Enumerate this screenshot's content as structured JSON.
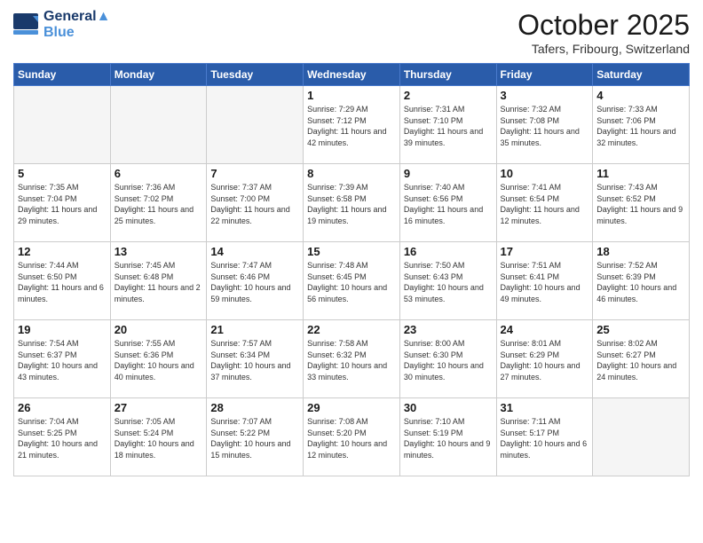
{
  "header": {
    "logo_line1": "General",
    "logo_line2": "Blue",
    "month": "October 2025",
    "location": "Tafers, Fribourg, Switzerland"
  },
  "days_of_week": [
    "Sunday",
    "Monday",
    "Tuesday",
    "Wednesday",
    "Thursday",
    "Friday",
    "Saturday"
  ],
  "weeks": [
    [
      {
        "num": "",
        "info": "",
        "empty": true
      },
      {
        "num": "",
        "info": "",
        "empty": true
      },
      {
        "num": "",
        "info": "",
        "empty": true
      },
      {
        "num": "1",
        "info": "Sunrise: 7:29 AM\nSunset: 7:12 PM\nDaylight: 11 hours\nand 42 minutes.",
        "empty": false
      },
      {
        "num": "2",
        "info": "Sunrise: 7:31 AM\nSunset: 7:10 PM\nDaylight: 11 hours\nand 39 minutes.",
        "empty": false
      },
      {
        "num": "3",
        "info": "Sunrise: 7:32 AM\nSunset: 7:08 PM\nDaylight: 11 hours\nand 35 minutes.",
        "empty": false
      },
      {
        "num": "4",
        "info": "Sunrise: 7:33 AM\nSunset: 7:06 PM\nDaylight: 11 hours\nand 32 minutes.",
        "empty": false
      }
    ],
    [
      {
        "num": "5",
        "info": "Sunrise: 7:35 AM\nSunset: 7:04 PM\nDaylight: 11 hours\nand 29 minutes.",
        "empty": false
      },
      {
        "num": "6",
        "info": "Sunrise: 7:36 AM\nSunset: 7:02 PM\nDaylight: 11 hours\nand 25 minutes.",
        "empty": false
      },
      {
        "num": "7",
        "info": "Sunrise: 7:37 AM\nSunset: 7:00 PM\nDaylight: 11 hours\nand 22 minutes.",
        "empty": false
      },
      {
        "num": "8",
        "info": "Sunrise: 7:39 AM\nSunset: 6:58 PM\nDaylight: 11 hours\nand 19 minutes.",
        "empty": false
      },
      {
        "num": "9",
        "info": "Sunrise: 7:40 AM\nSunset: 6:56 PM\nDaylight: 11 hours\nand 16 minutes.",
        "empty": false
      },
      {
        "num": "10",
        "info": "Sunrise: 7:41 AM\nSunset: 6:54 PM\nDaylight: 11 hours\nand 12 minutes.",
        "empty": false
      },
      {
        "num": "11",
        "info": "Sunrise: 7:43 AM\nSunset: 6:52 PM\nDaylight: 11 hours\nand 9 minutes.",
        "empty": false
      }
    ],
    [
      {
        "num": "12",
        "info": "Sunrise: 7:44 AM\nSunset: 6:50 PM\nDaylight: 11 hours\nand 6 minutes.",
        "empty": false
      },
      {
        "num": "13",
        "info": "Sunrise: 7:45 AM\nSunset: 6:48 PM\nDaylight: 11 hours\nand 2 minutes.",
        "empty": false
      },
      {
        "num": "14",
        "info": "Sunrise: 7:47 AM\nSunset: 6:46 PM\nDaylight: 10 hours\nand 59 minutes.",
        "empty": false
      },
      {
        "num": "15",
        "info": "Sunrise: 7:48 AM\nSunset: 6:45 PM\nDaylight: 10 hours\nand 56 minutes.",
        "empty": false
      },
      {
        "num": "16",
        "info": "Sunrise: 7:50 AM\nSunset: 6:43 PM\nDaylight: 10 hours\nand 53 minutes.",
        "empty": false
      },
      {
        "num": "17",
        "info": "Sunrise: 7:51 AM\nSunset: 6:41 PM\nDaylight: 10 hours\nand 49 minutes.",
        "empty": false
      },
      {
        "num": "18",
        "info": "Sunrise: 7:52 AM\nSunset: 6:39 PM\nDaylight: 10 hours\nand 46 minutes.",
        "empty": false
      }
    ],
    [
      {
        "num": "19",
        "info": "Sunrise: 7:54 AM\nSunset: 6:37 PM\nDaylight: 10 hours\nand 43 minutes.",
        "empty": false
      },
      {
        "num": "20",
        "info": "Sunrise: 7:55 AM\nSunset: 6:36 PM\nDaylight: 10 hours\nand 40 minutes.",
        "empty": false
      },
      {
        "num": "21",
        "info": "Sunrise: 7:57 AM\nSunset: 6:34 PM\nDaylight: 10 hours\nand 37 minutes.",
        "empty": false
      },
      {
        "num": "22",
        "info": "Sunrise: 7:58 AM\nSunset: 6:32 PM\nDaylight: 10 hours\nand 33 minutes.",
        "empty": false
      },
      {
        "num": "23",
        "info": "Sunrise: 8:00 AM\nSunset: 6:30 PM\nDaylight: 10 hours\nand 30 minutes.",
        "empty": false
      },
      {
        "num": "24",
        "info": "Sunrise: 8:01 AM\nSunset: 6:29 PM\nDaylight: 10 hours\nand 27 minutes.",
        "empty": false
      },
      {
        "num": "25",
        "info": "Sunrise: 8:02 AM\nSunset: 6:27 PM\nDaylight: 10 hours\nand 24 minutes.",
        "empty": false
      }
    ],
    [
      {
        "num": "26",
        "info": "Sunrise: 7:04 AM\nSunset: 5:25 PM\nDaylight: 10 hours\nand 21 minutes.",
        "empty": false
      },
      {
        "num": "27",
        "info": "Sunrise: 7:05 AM\nSunset: 5:24 PM\nDaylight: 10 hours\nand 18 minutes.",
        "empty": false
      },
      {
        "num": "28",
        "info": "Sunrise: 7:07 AM\nSunset: 5:22 PM\nDaylight: 10 hours\nand 15 minutes.",
        "empty": false
      },
      {
        "num": "29",
        "info": "Sunrise: 7:08 AM\nSunset: 5:20 PM\nDaylight: 10 hours\nand 12 minutes.",
        "empty": false
      },
      {
        "num": "30",
        "info": "Sunrise: 7:10 AM\nSunset: 5:19 PM\nDaylight: 10 hours\nand 9 minutes.",
        "empty": false
      },
      {
        "num": "31",
        "info": "Sunrise: 7:11 AM\nSunset: 5:17 PM\nDaylight: 10 hours\nand 6 minutes.",
        "empty": false
      },
      {
        "num": "",
        "info": "",
        "empty": true
      }
    ]
  ]
}
